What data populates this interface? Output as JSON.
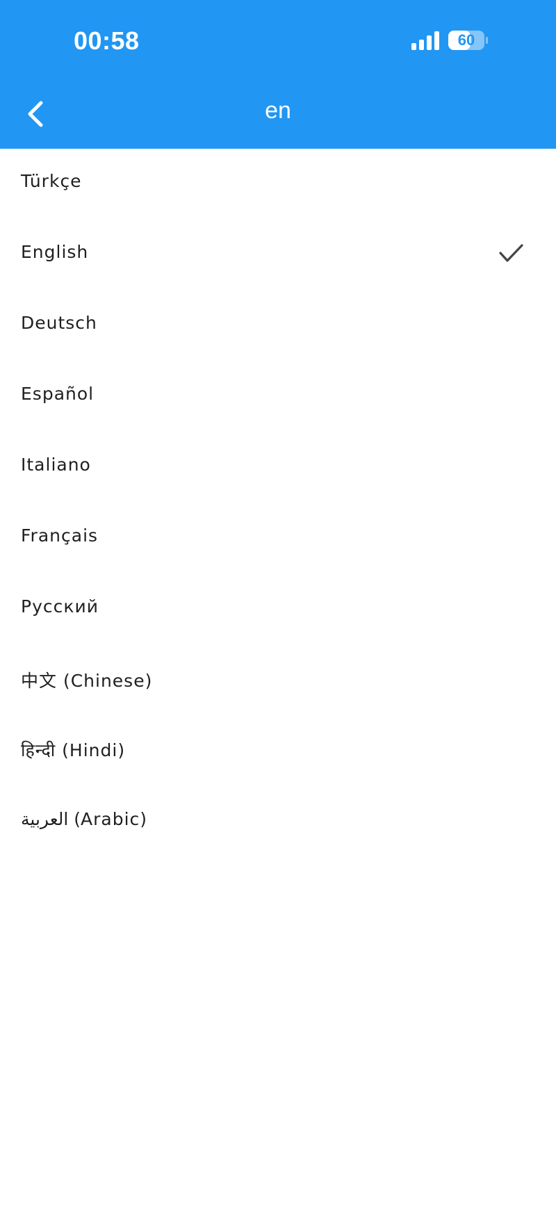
{
  "status_bar": {
    "time": "00:58",
    "battery": "60",
    "signal_icon": "cellular-signal-icon",
    "battery_icon": "battery-icon"
  },
  "nav": {
    "title": "en",
    "back_icon": "chevron-left-icon"
  },
  "colors": {
    "header_bg": "#2196F3",
    "text": "#1f1f1f",
    "check": "#444444"
  },
  "languages": [
    {
      "label": "Türkçe",
      "selected": false
    },
    {
      "label": "English",
      "selected": true
    },
    {
      "label": "Deutsch",
      "selected": false
    },
    {
      "label": "Español",
      "selected": false
    },
    {
      "label": "Italiano",
      "selected": false
    },
    {
      "label": "Français",
      "selected": false
    },
    {
      "label": "Русский",
      "selected": false
    },
    {
      "label": "中文 (Chinese)",
      "selected": false
    },
    {
      "label": "हिन्दी (Hindi)",
      "selected": false
    },
    {
      "label": "العربية (Arabic)",
      "selected": false
    }
  ],
  "selected_icon": "checkmark-icon"
}
